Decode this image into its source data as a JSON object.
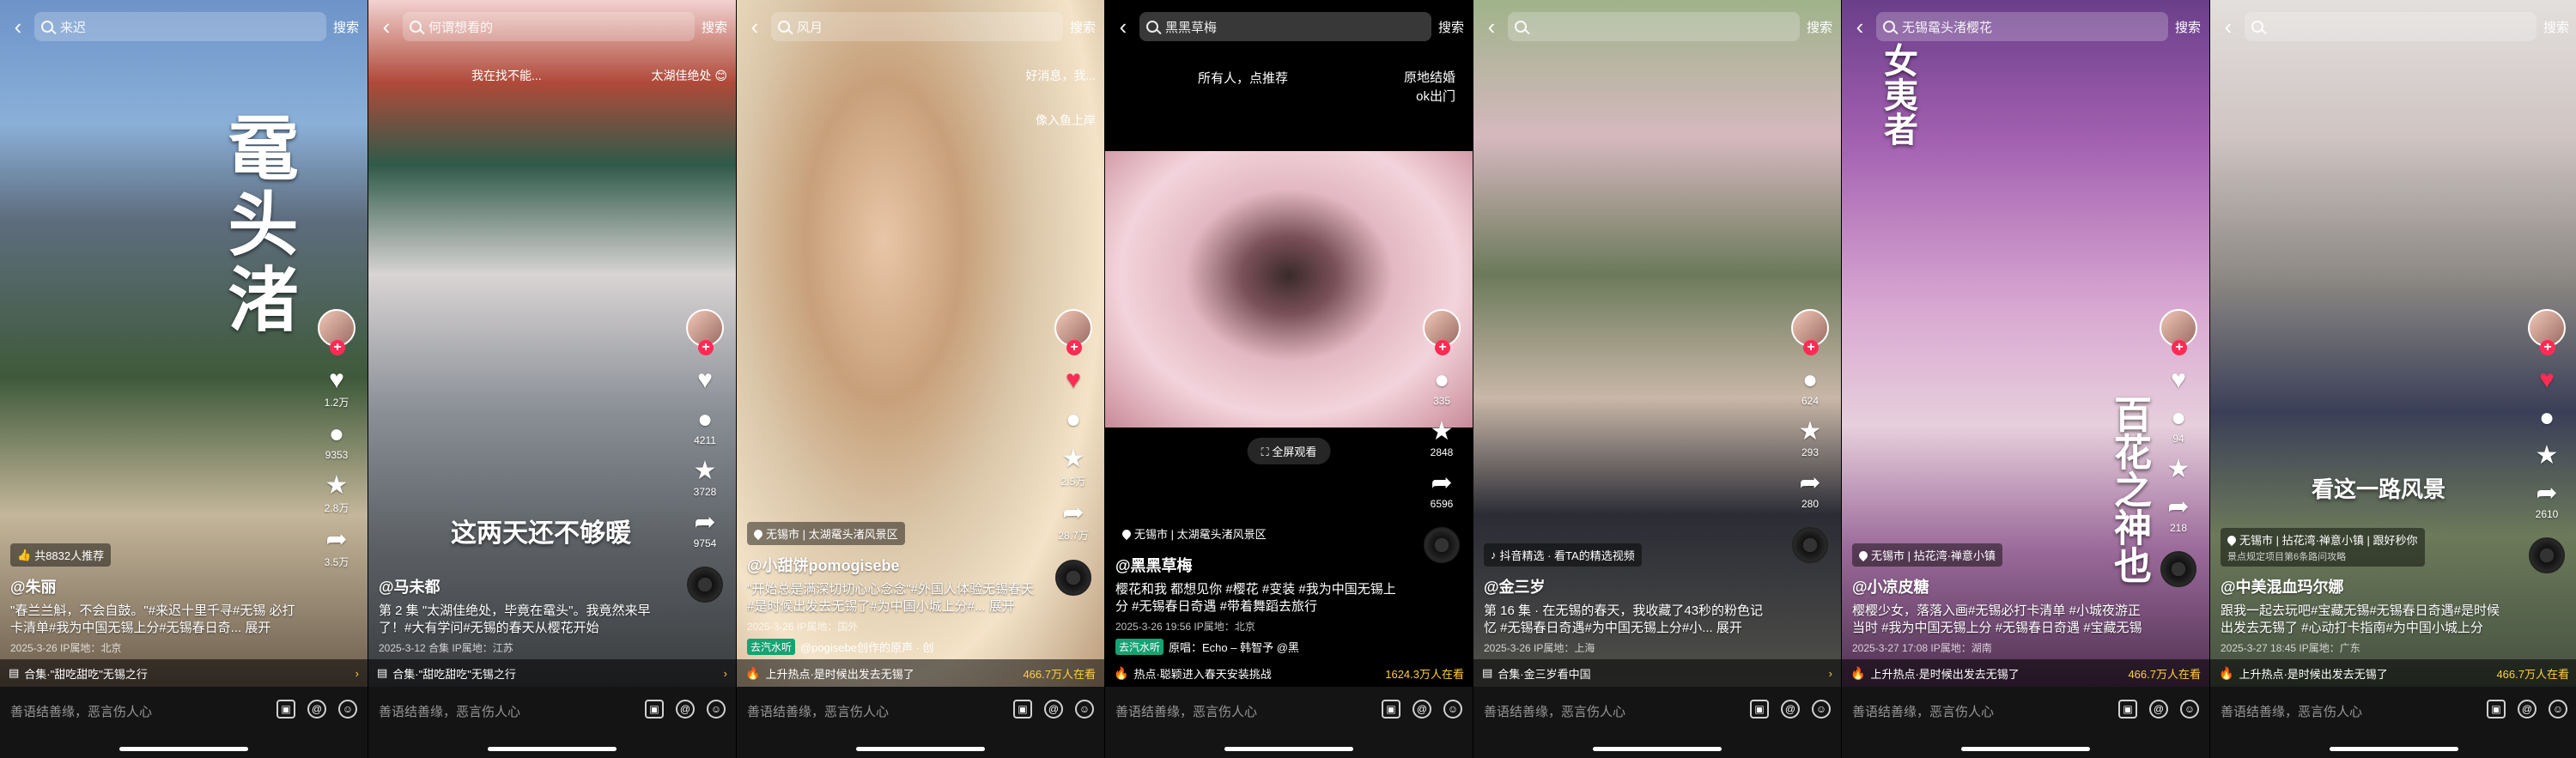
{
  "comment_placeholder": "善语结善缘，恶言伤人心",
  "panels": [
    {
      "search": {
        "query": "来迟",
        "button": "搜索"
      },
      "overlay_title": "鼋头渚",
      "rail": {
        "likes": "1.2万",
        "comments": "9353",
        "favorites": "2.8万",
        "shares": "3.5万"
      },
      "recommend": "共8832人推荐",
      "author": "@朱丽",
      "caption": "\"春兰兰斛，不会自鼓。\"#来迟十里千寻#无锡 必打卡清单#我为中国无锡上分#无锡春日奇... 展开",
      "meta": "2025-3-26 IP属地：北京",
      "banner_left": "合集·\"甜吃甜吃\"无锡之行",
      "banner_right": ""
    },
    {
      "search": {
        "query": "何谓想看的",
        "button": "搜索"
      },
      "top_note_left": "我在找不能...",
      "top_note_right": "太湖佳绝处 😊",
      "overlay_subtitle": "这两天还不够暖",
      "rail": {
        "likes": "",
        "comments": "4211",
        "favorites": "3728",
        "shares": "9754"
      },
      "author": "@马未都",
      "caption": "第 2 集 \"太湖佳绝处，毕竟在鼋头\"。我竟然来早了！#大有学问#无锡的春天从樱花开始",
      "meta": "2025-3-12 合集 IP属地：江苏",
      "banner_left": "合集·\"甜吃甜吃\"无锡之行",
      "banner_right": ""
    },
    {
      "search": {
        "query": "风月",
        "button": "搜索"
      },
      "top_note_left": "好消息，我...",
      "top_note_right": "像入鱼上岸",
      "rail": {
        "likes": "",
        "comments": "",
        "favorites": "2.5万",
        "shares": "28.7万"
      },
      "location": "无锡市 | 太湖鼋头渚风景区",
      "author": "@小甜饼pomogisebe",
      "caption": "\"开始总是满深切切心心念念\"#外国人体验无锡春天 #是时候出发去无锡了#为中国小城上分#... 展开",
      "meta": "2025-3-26 IP属地：国外",
      "music_tag": "去汽水听",
      "music": "@pogisebe创作的原声 · 创",
      "banner_left": "上升热点·是时候出发去无锡了",
      "banner_right": "466.7万人在看"
    },
    {
      "search": {
        "query": "黑黑草梅",
        "button": "搜索"
      },
      "top_line_left": "所有人，点推荐",
      "top_line_right": "原地结婚\nok出门",
      "rail": {
        "likes": "335",
        "comments": "",
        "favorites": "2848",
        "shares": "6596"
      },
      "fullscreen": "全屏观看",
      "location": "无锡市 | 太湖鼋头渚风景区",
      "author": "@黑黑草梅",
      "caption": "樱花和我 都想见你 #樱花 #变装 #我为中国无锡上分 #无锡春日奇遇 #带着舞蹈去旅行",
      "meta": "2025-3-26 19:56 IP属地：北京",
      "music_tag": "去汽水听",
      "music": "原唱：Echo – 韩智予  @黑",
      "banner_left": "热点·聪颖进入春天安装挑战",
      "banner_right": "1624.3万人在看"
    },
    {
      "search": {
        "query": "",
        "button": "搜索"
      },
      "rail": {
        "likes": "",
        "comments": "624",
        "favorites": "293",
        "shares": "280"
      },
      "promo": "抖音精选 · 看TA的精选视频",
      "author": "@金三岁",
      "caption": "第 16 集 · 在无锡的春天，我收藏了43秒的粉色记忆 #无锡春日奇遇#为中国无锡上分#小... 展开",
      "meta": "2025-3-26 IP属地：上海",
      "banner_left": "合集·金三岁看中国",
      "banner_right": ""
    },
    {
      "search": {
        "query": "无锡鼋头渚樱花",
        "button": "搜索"
      },
      "overlay_left": "女夷者",
      "overlay_right": "百花之神也",
      "rail": {
        "likes": "",
        "comments": "94",
        "favorites": "",
        "shares": "218"
      },
      "location": "无锡市 | 拈花湾·禅意小镇",
      "author": "@小凉皮糖",
      "caption": "樱樱少女，落落入画#无锡必打卡清单 #小城夜游正当时 #我为中国无锡上分 #无锡春日奇遇 #宝藏无锡",
      "meta": "2025-3-27 17:08 IP属地：湖南",
      "banner_left": "上升热点·是时候出发去无锡了",
      "banner_right": "466.7万人在看"
    },
    {
      "search": {
        "query": "",
        "button": "搜索"
      },
      "overlay_subtitle": "看这一路风景",
      "rail": {
        "likes": "",
        "comments": "",
        "favorites": "",
        "shares": "2610"
      },
      "location": "无锡市 | 拈花湾·禅意小镇 | 跟好秒你",
      "location_sub": "景点规定项目第6条路问攻略",
      "author": "@中美混血玛尔娜",
      "caption": "跟我一起去玩吧#宝藏无锡#无锡春日奇遇#是时候出发去无锡了 #心动打卡指南#为中国小城上分",
      "meta": "2025-3-27 18:45 IP属地：广东",
      "banner_left": "上升热点·是时候出发去无锡了",
      "banner_right": "466.7万人在看"
    }
  ]
}
